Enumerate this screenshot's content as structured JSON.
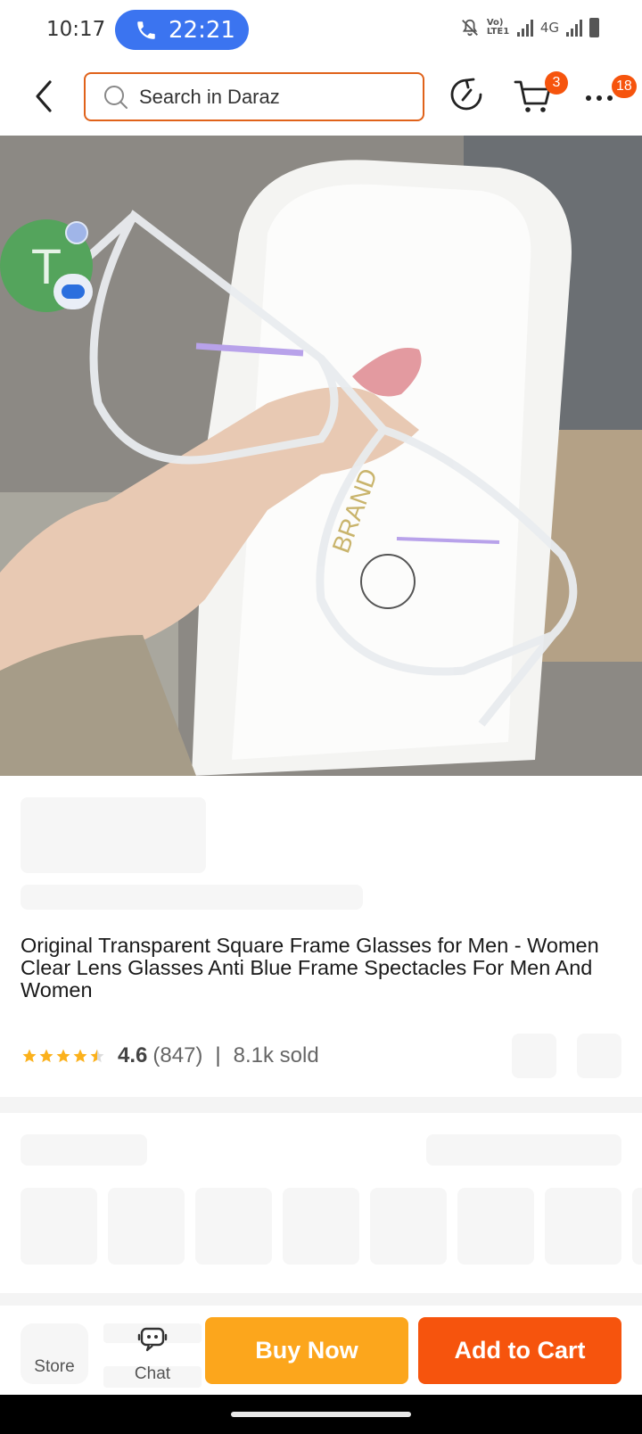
{
  "status_bar": {
    "time": "10:17",
    "call_time": "22:21",
    "network": "4G",
    "volte": "Vo) LTE1"
  },
  "header": {
    "search_placeholder": "Search in Daraz",
    "cart_count": "3",
    "more_count": "18",
    "accent_color": "#e0621a",
    "badge_color": "#f6540d"
  },
  "product_image": {
    "avatar_letter": "T",
    "icons": [
      "back-arrow-icon",
      "search-icon",
      "refresh-icon",
      "cart-icon",
      "more-icon"
    ]
  },
  "product": {
    "title": "Original Transparent Square Frame Glasses for Men - Women Clear Lens Glasses Anti Blue Frame Spectacles For Men And Women",
    "rating": "4.6",
    "review_count": "(847)",
    "separator": "|",
    "sold": "8.1k sold",
    "star_rating_value": 4.5
  },
  "action_bar": {
    "store_label": "Store",
    "chat_label": "Chat",
    "buy_now_label": "Buy Now",
    "add_to_cart_label": "Add to Cart",
    "buy_color": "#fca61c",
    "cart_color": "#f6540d"
  }
}
